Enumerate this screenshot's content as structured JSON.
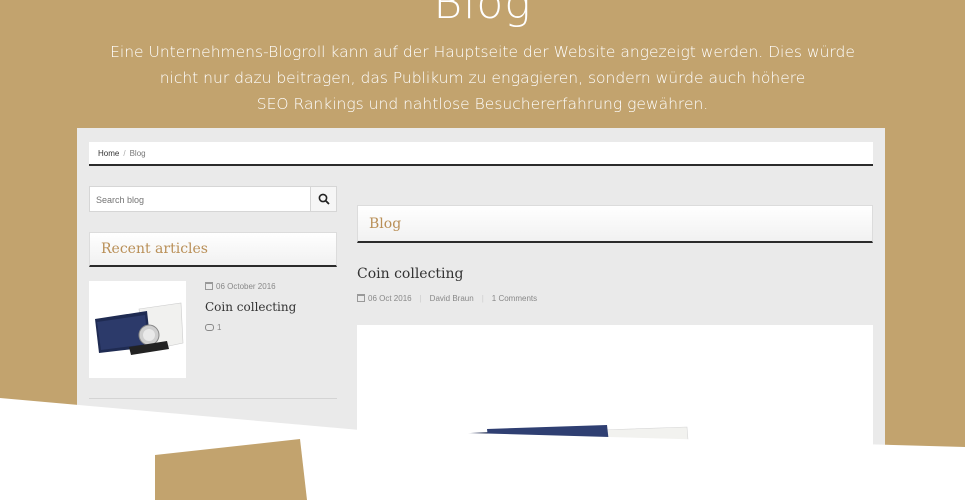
{
  "hero": {
    "title": "Blog",
    "description_lines": [
      "Eine Unternehmens-Blogroll kann auf der Hauptseite der Website angezeigt werden. Dies würde",
      "nicht nur dazu beitragen, das Publikum zu engagieren, sondern würde auch höhere",
      "SEO Rankings und nahtlose Besuchererfahrung gewähren."
    ]
  },
  "breadcrumb": {
    "home": "Home",
    "separator": "/",
    "current": "Blog"
  },
  "search": {
    "placeholder": "Search blog",
    "icon": "search-icon"
  },
  "sidebar": {
    "recent_heading": "Recent articles",
    "article": {
      "date": "06 October 2016",
      "title": "Coin collecting",
      "comments": "1",
      "date_icon": "calendar-icon",
      "comments_icon": "comments-icon"
    }
  },
  "main": {
    "heading": "Blog",
    "post": {
      "title": "Coin collecting",
      "date": "06 Oct 2016",
      "author": "David Braun",
      "comments": "1 Comments"
    }
  },
  "colors": {
    "brand": "#c2a36e",
    "accent_text": "#b98f57",
    "panel_bg": "#eaeaea"
  }
}
